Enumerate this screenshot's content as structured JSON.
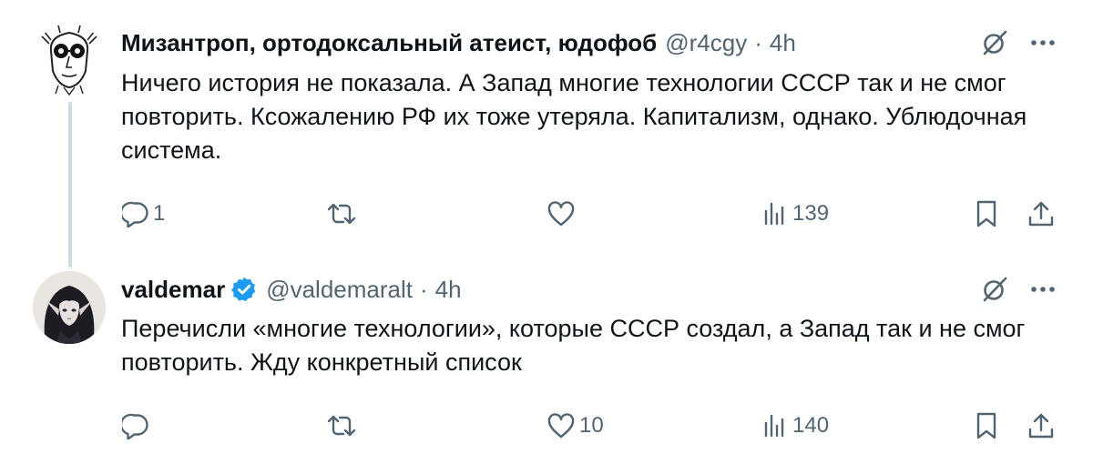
{
  "tweets": [
    {
      "name": "Мизантроп, ортодоксальный атеист, юдофоб",
      "handle": "@r4cgy",
      "separator": "·",
      "time": "4h",
      "verified": false,
      "text": "Ничего история не показала. А Запад многие технологии СССР так и не смог повторить. Ксожалению РФ их тоже утеряла. Капитализм, однако. Ублюдочная система.",
      "replies": "1",
      "retweets": "",
      "likes": "",
      "views": "139"
    },
    {
      "name": "valdemar",
      "handle": "@valdemaralt",
      "separator": "·",
      "time": "4h",
      "verified": true,
      "text": "Перечисли «многие технологии», которые СССР создал, а Запад так и не смог повторить. Жду конкретный список",
      "replies": "",
      "retweets": "",
      "likes": "10",
      "views": "140"
    }
  ],
  "colors": {
    "text": "#0f1419",
    "secondary": "#536471",
    "verified_badge": "#1d9bf0",
    "thread_line": "#cfd9de"
  },
  "icons": [
    "avatar-image",
    "verified-badge-icon",
    "grok-icon",
    "more-icon",
    "reply-icon",
    "retweet-icon",
    "like-icon",
    "views-icon",
    "bookmark-icon",
    "share-icon"
  ]
}
